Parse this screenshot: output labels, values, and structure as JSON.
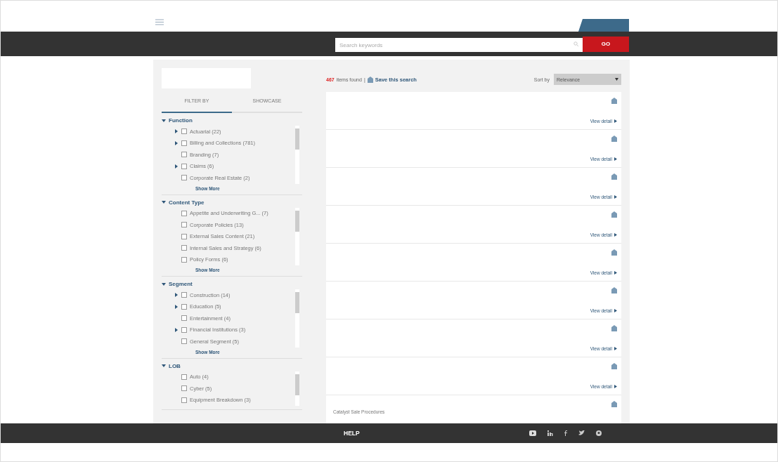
{
  "header": {
    "search": {
      "placeholder": "Search keywords"
    },
    "go_button": "GO"
  },
  "sidebar": {
    "tabs": [
      {
        "label": "FILTER BY",
        "selected": true
      },
      {
        "label": "SHOWCASE",
        "selected": false
      }
    ],
    "groups": [
      {
        "title": "Function",
        "expanded": true,
        "more": "Show More",
        "items": [
          {
            "label": "Actuarial (22)",
            "has_children": true,
            "checked": false
          },
          {
            "label": "Billing and Collections (781)",
            "has_children": true,
            "checked": false
          },
          {
            "label": "Branding (7)",
            "has_children": false,
            "checked": false
          },
          {
            "label": "Claims (6)",
            "has_children": true,
            "checked": false
          },
          {
            "label": "Corporate Real Estate (2)",
            "has_children": false,
            "checked": false
          }
        ]
      },
      {
        "title": "Content Type",
        "expanded": true,
        "more": "Show More",
        "items": [
          {
            "label": "Appetite and Underwriting G... (7)",
            "has_children": false,
            "checked": false
          },
          {
            "label": "Corporate Policies (13)",
            "has_children": false,
            "checked": false
          },
          {
            "label": "External Sales Content (21)",
            "has_children": false,
            "checked": false
          },
          {
            "label": "Internal Sales and Strategy (6)",
            "has_children": false,
            "checked": false
          },
          {
            "label": "Policy Forms (6)",
            "has_children": false,
            "checked": false
          }
        ]
      },
      {
        "title": "Segment",
        "expanded": true,
        "more": "Show More",
        "items": [
          {
            "label": "Construction (14)",
            "has_children": true,
            "checked": false
          },
          {
            "label": "Education (5)",
            "has_children": true,
            "checked": false
          },
          {
            "label": "Entertainment (4)",
            "has_children": false,
            "checked": false
          },
          {
            "label": "Financial Institutions (3)",
            "has_children": true,
            "checked": false
          },
          {
            "label": "General Segment (5)",
            "has_children": false,
            "checked": false
          }
        ]
      },
      {
        "title": "LOB",
        "expanded": true,
        "items": [
          {
            "label": "Auto (4)",
            "has_children": false,
            "checked": false
          },
          {
            "label": "Cyber (5)",
            "has_children": false,
            "checked": false
          },
          {
            "label": "Equipment Breakdown (3)",
            "has_children": false,
            "checked": false
          }
        ]
      }
    ]
  },
  "results_bar": {
    "count": "467",
    "count_label": "items found",
    "separator": "|",
    "save_search": "Save this search",
    "sort_label": "Sort by",
    "sort_value": "Relevance"
  },
  "results": [
    {
      "link": "View detail"
    },
    {
      "link": "View detail"
    },
    {
      "link": "View detail"
    },
    {
      "link": "View detail"
    },
    {
      "link": "View detail"
    },
    {
      "link": "View detail"
    },
    {
      "link": "View detail"
    },
    {
      "link": "View detail"
    },
    {
      "title": "Catalyst Sale Procedures"
    }
  ],
  "footer": {
    "help": "HELP"
  }
}
